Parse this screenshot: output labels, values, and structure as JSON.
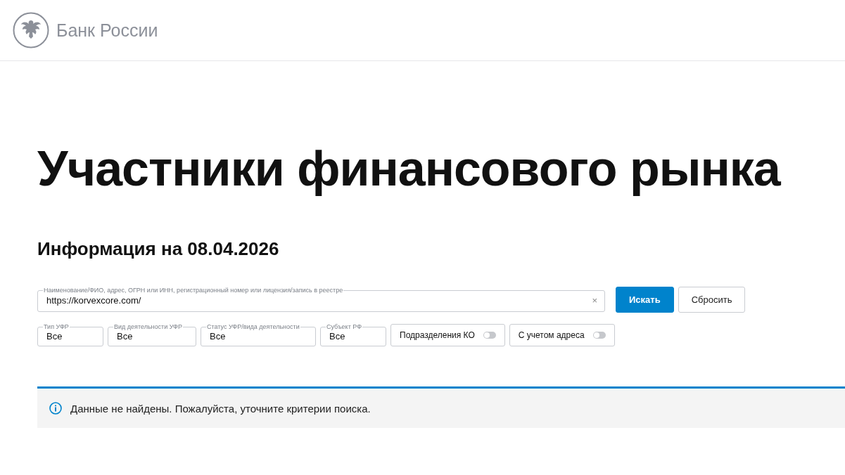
{
  "header": {
    "logo_text": "Банк России"
  },
  "title": "Участники финансового рынка",
  "subtitle": "Информация на 08.04.2026",
  "search": {
    "label": "Наименование/ФИО, адрес, ОГРН или ИНН, регистрационный номер или лицензия/запись в реестре",
    "value": "https://korvexcore.com/",
    "clear": "×"
  },
  "buttons": [
    {
      "label": "Искать",
      "kind": "primary"
    },
    {
      "label": "Сбросить",
      "kind": "secondary"
    }
  ],
  "filters": [
    {
      "label": "Тип УФР",
      "value": "Все"
    },
    {
      "label": "Вид деятельности УФР",
      "value": "Все"
    },
    {
      "label": "Статус УФР/вида деятельности",
      "value": "Все"
    },
    {
      "label": "Субъект РФ",
      "value": "Все"
    }
  ],
  "toggles": [
    {
      "label": "Подразделения КО",
      "on": false
    },
    {
      "label": "С учетом адреса",
      "on": false
    }
  ],
  "alert": {
    "message": "Данные не найдены. Пожалуйста, уточните критерии поиска."
  }
}
